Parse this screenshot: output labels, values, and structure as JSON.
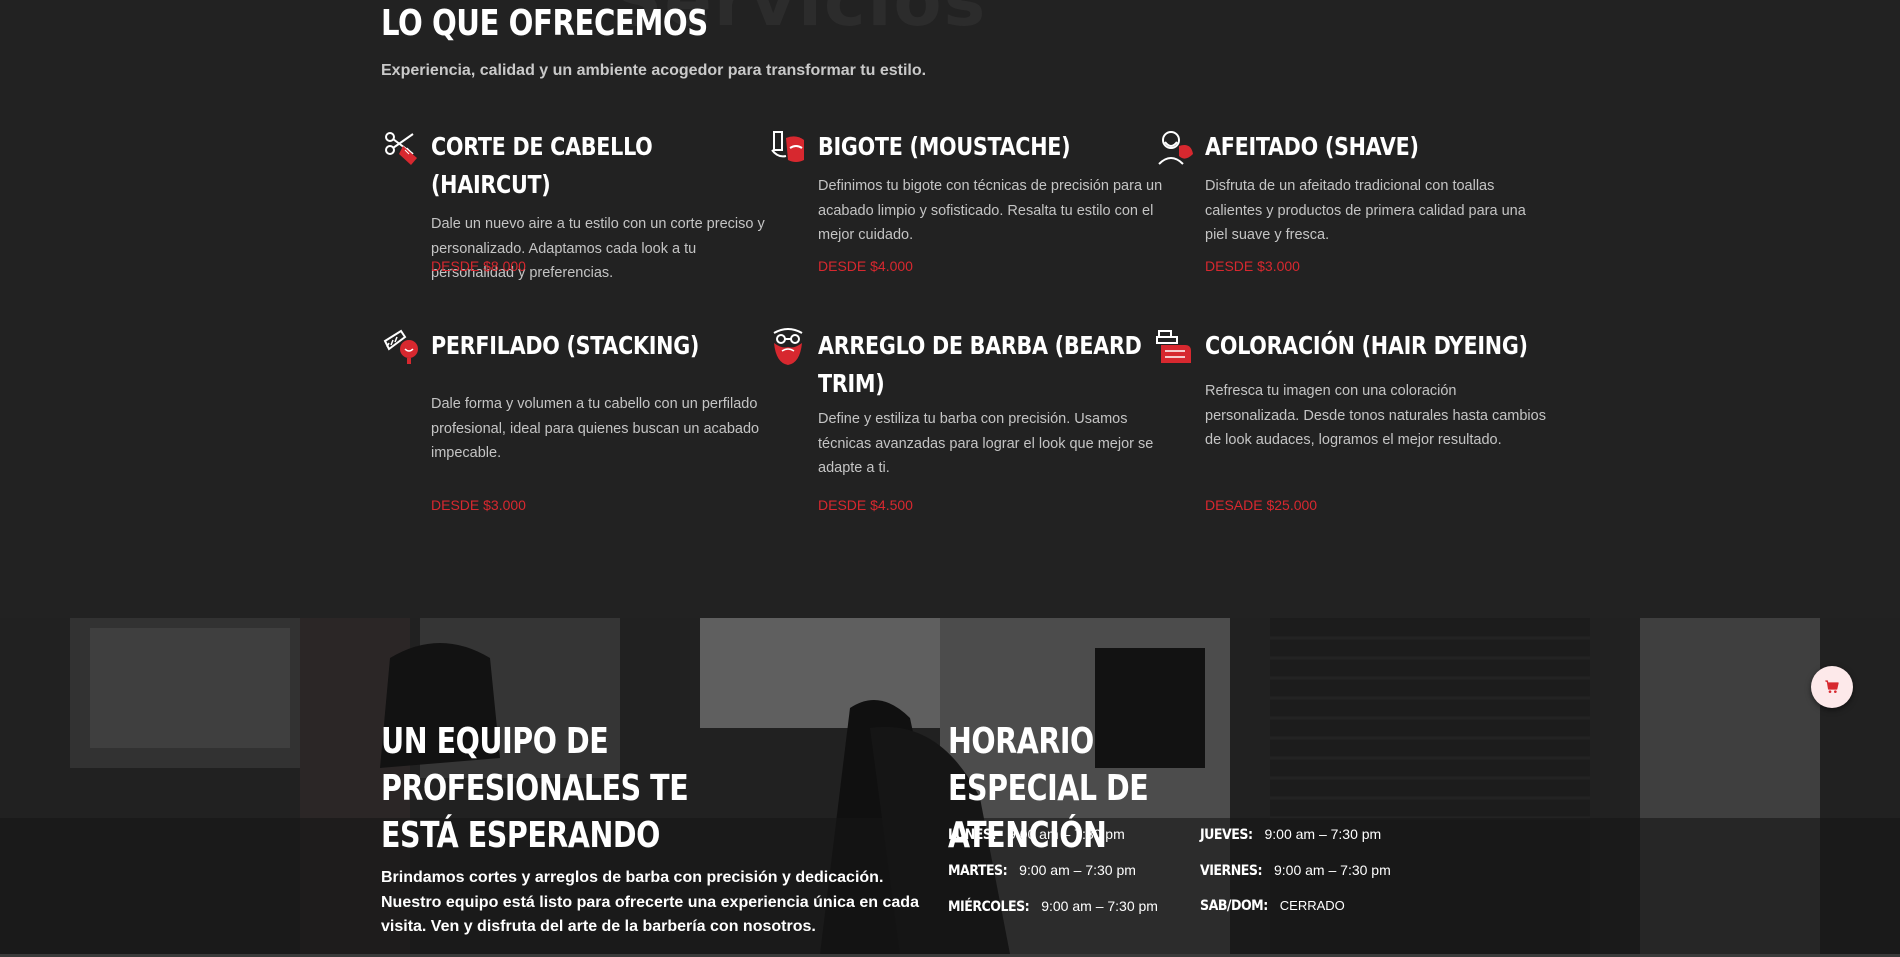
{
  "services_section": {
    "background_word": "Servicios",
    "title": "LO QUE OFRECEMOS",
    "subtitle": "Experiencia, calidad y un ambiente acogedor para transformar tu estilo.",
    "accent_color": "#d7282f",
    "items": [
      {
        "icon": "scissors-comb-icon",
        "title": "CORTE DE CABELLO (HAIRCUT)",
        "description": "Dale un nuevo aire a tu estilo con un corte preciso y personalizado. Adaptamos cada look a tu personalidad y preferencias.",
        "price": "DESDE $8.000"
      },
      {
        "icon": "razor-moustache-icon",
        "title": "BIGOTE (MOUSTACHE)",
        "description": "Definimos tu bigote con técnicas de precisión para un acabado limpio y sofisticado. Resalta tu estilo con el mejor cuidado.",
        "price": "DESDE $4.000"
      },
      {
        "icon": "shaving-man-icon",
        "title": "AFEITADO (SHAVE)",
        "description": "Disfruta de un afeitado tradicional con toallas calientes y productos de primera calidad para una piel suave y fresca.",
        "price": "DESDE $3.000"
      },
      {
        "icon": "comb-head-icon",
        "title": "PERFILADO (STACKING)",
        "description": "Dale forma y volumen a tu cabello con un perfilado profesional, ideal para quienes buscan un acabado impecable.",
        "price": "DESDE $3.000"
      },
      {
        "icon": "bearded-man-icon",
        "title": "ARREGLO DE BARBA (BEARD TRIM)",
        "description": "Define y estiliza tu barba con precisión. Usamos técnicas avanzadas para lograr el look que mejor se adapte a ti.",
        "price": "DESDE $4.500"
      },
      {
        "icon": "hair-dye-bottle-icon",
        "title": "COLORACIÓN (HAIR DYEING)",
        "description": "Refresca tu imagen con una coloración personalizada. Desde tonos naturales hasta cambios de look audaces, logramos el mejor resultado.",
        "price": "DESADE $25.000"
      }
    ]
  },
  "team_section": {
    "title": "UN EQUIPO DE PROFESIONALES TE ESTÁ ESPERANDO",
    "text": "Brindamos cortes y arreglos de barba con precisión y dedicación. Nuestro equipo está listo para ofrecerte una experiencia única en cada visita. Ven y disfruta del arte de la barbería con nosotros."
  },
  "hours_section": {
    "title": "HORARIO ESPECIAL DE ATENCIÓN",
    "rows": [
      {
        "day": "LUNES:",
        "time": "9:00 am – 7:30 pm"
      },
      {
        "day": "MARTES:",
        "time": "9:00 am – 7:30 pm"
      },
      {
        "day": "MIÉRCOLES:",
        "time": "9:00 am – 7:30 pm"
      },
      {
        "day": "JUEVES:",
        "time": "9:00 am – 7:30 pm"
      },
      {
        "day": "VIERNES:",
        "time": "9:00 am – 7:30 pm"
      },
      {
        "day": "SAB/DOM:",
        "time": "CERRADO"
      }
    ]
  },
  "cart": {
    "icon": "cart-icon",
    "color": "#d7282f"
  }
}
